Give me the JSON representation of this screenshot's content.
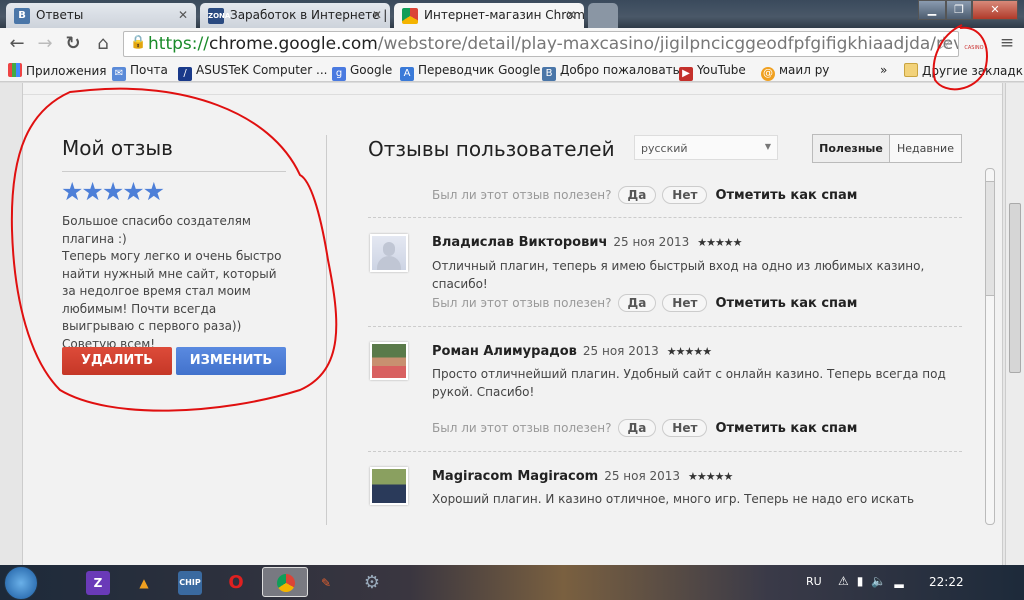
{
  "browser": {
    "tabs": [
      {
        "title": "Ответы",
        "icon": "vk-icon"
      },
      {
        "title": "Заработок в Интернете |",
        "icon": "shp-zona-icon"
      },
      {
        "title": "Интернет-магазин Chrom",
        "icon": "chrome-webstore-icon",
        "active": true
      }
    ],
    "url": {
      "scheme": "https://",
      "domain": "chrome.google.com",
      "path": "/webstore/detail/play-maxcasino/jigilpncicggeodfpfgifigkhiaadjda/reviews"
    },
    "extension_label": "CASINO",
    "bookmarks": [
      {
        "label": "Приложения",
        "icon": "apps-icon"
      },
      {
        "label": "Почта",
        "icon": "mail-icon"
      },
      {
        "label": "ASUSTeK Computer ...",
        "icon": "asus-icon"
      },
      {
        "label": "Google",
        "icon": "google-icon"
      },
      {
        "label": "Переводчик Google",
        "icon": "translate-icon"
      },
      {
        "label": "Добро пожаловать",
        "icon": "vk-icon"
      },
      {
        "label": "YouTube",
        "icon": "youtube-icon"
      },
      {
        "label": "маил ру",
        "icon": "mailru-icon"
      }
    ],
    "bookmarks_overflow": "»",
    "other_bookmarks": "Другие закладки"
  },
  "my_review": {
    "title": "Мой отзыв",
    "rating": 5,
    "stars": "★★★★★",
    "text": "Большое спасибо создателям плагина :)\nТеперь могу легко и очень быстро найти нужный мне сайт, который за недолгое время стал моим любимым! Почти всегда выигрываю с первого раза)) Советую всем!",
    "delete_label": "УДАЛИТЬ",
    "edit_label": "ИЗМЕНИТЬ",
    "delete_color": "#d14836",
    "edit_color": "#4d7fd8"
  },
  "user_reviews": {
    "title": "Отзывы пользователей",
    "language": "русский",
    "sort_helpful": "Полезные",
    "sort_recent": "Недавние",
    "helpful_question": "Был ли этот отзыв полезен?",
    "yes": "Да",
    "no": "Нет",
    "spam": "Отметить как спам",
    "reviews": [
      {
        "author": "Владислав Викторович",
        "date": "25 ноя 2013",
        "stars": "★★★★★",
        "text": "Отличный плагин, теперь я имею быстрый вход на одно из любимых казино, спасибо!"
      },
      {
        "author": "Роман Алимурадов",
        "date": "25 ноя 2013",
        "stars": "★★★★★",
        "text": "Просто отличнейший плагин. Удобный сайт с онлайн казино. Теперь всегда под рукой. Спасибо!"
      },
      {
        "author": "Magiracom Magiracom",
        "date": "25 ноя 2013",
        "stars": "★★★★★",
        "text": "Хороший плагин. И казино отличное, много игр. Теперь не надо его искать"
      }
    ]
  },
  "taskbar": {
    "language": "RU",
    "clock": "22:22"
  }
}
